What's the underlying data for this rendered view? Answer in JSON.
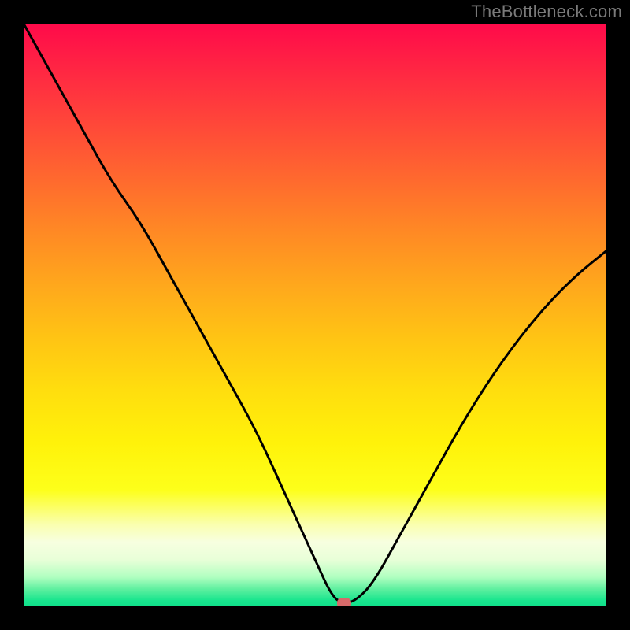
{
  "watermark": "TheBottleneck.com",
  "chart_data": {
    "type": "line",
    "title": "",
    "xlabel": "",
    "ylabel": "",
    "xlim": [
      0,
      100
    ],
    "ylim": [
      0,
      100
    ],
    "grid": false,
    "legend": false,
    "annotations": [],
    "series": [
      {
        "name": "curve",
        "x": [
          0,
          5,
          10,
          15,
          20,
          25,
          30,
          35,
          40,
          45,
          50,
          53,
          55,
          57,
          60,
          65,
          70,
          75,
          80,
          85,
          90,
          95,
          100
        ],
        "values": [
          100,
          91,
          82,
          73,
          66,
          57,
          48,
          39,
          30,
          19,
          8,
          1.5,
          0.5,
          1,
          4,
          13,
          22,
          31,
          39,
          46,
          52,
          57,
          61
        ]
      }
    ],
    "marker": {
      "x": 55,
      "y": 0.5
    },
    "background_gradient": {
      "stops": [
        {
          "pos": 0.0,
          "color": "#ff0a4a"
        },
        {
          "pos": 0.18,
          "color": "#ff4a38"
        },
        {
          "pos": 0.36,
          "color": "#ff8a24"
        },
        {
          "pos": 0.54,
          "color": "#ffc414"
        },
        {
          "pos": 0.72,
          "color": "#fff20a"
        },
        {
          "pos": 0.86,
          "color": "#faffb0"
        },
        {
          "pos": 0.95,
          "color": "#b0ffc0"
        },
        {
          "pos": 1.0,
          "color": "#10df8a"
        }
      ]
    }
  }
}
